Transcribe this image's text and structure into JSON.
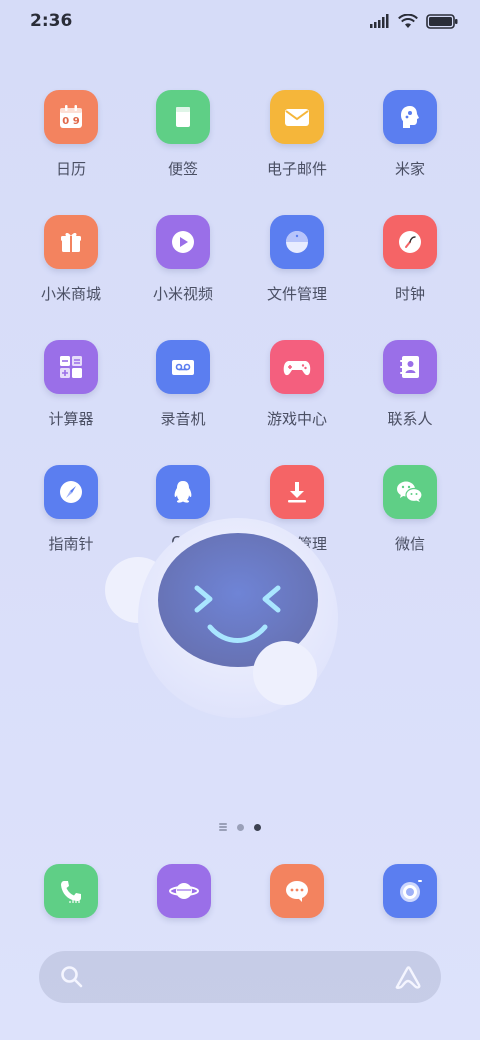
{
  "status_bar": {
    "time": "2:36"
  },
  "apps": [
    {
      "label": "日历",
      "icon": "calendar-icon",
      "color": "#f3835f",
      "icon_text": "0 9"
    },
    {
      "label": "便签",
      "icon": "notes-icon",
      "color": "#5fcf86"
    },
    {
      "label": "电子邮件",
      "icon": "email-icon",
      "color": "#f5b63a"
    },
    {
      "label": "米家",
      "icon": "mijia-icon",
      "color": "#5b7ef0"
    },
    {
      "label": "小米商城",
      "icon": "gift-icon",
      "color": "#f3835f"
    },
    {
      "label": "小米视频",
      "icon": "video-play-icon",
      "color": "#9a6fe8"
    },
    {
      "label": "文件管理",
      "icon": "file-manager-icon",
      "color": "#5b7ef0"
    },
    {
      "label": "时钟",
      "icon": "clock-icon",
      "color": "#f56466"
    },
    {
      "label": "计算器",
      "icon": "calculator-icon",
      "color": "#9a6fe8"
    },
    {
      "label": "录音机",
      "icon": "recorder-icon",
      "color": "#5b7ef0"
    },
    {
      "label": "游戏中心",
      "icon": "gamepad-icon",
      "color": "#f45f7e"
    },
    {
      "label": "联系人",
      "icon": "contacts-icon",
      "color": "#9a6fe8"
    },
    {
      "label": "指南针",
      "icon": "compass-icon",
      "color": "#5b7ef0"
    },
    {
      "label": "QQ",
      "icon": "qq-penguin-icon",
      "color": "#5b7ef0"
    },
    {
      "label": "下载管理",
      "icon": "download-icon",
      "color": "#f56466"
    },
    {
      "label": "微信",
      "icon": "wechat-icon",
      "color": "#5fcf86"
    }
  ],
  "dock": [
    {
      "icon": "phone-icon",
      "color": "#5fcf86"
    },
    {
      "icon": "browser-planet-icon",
      "color": "#9a6fe8"
    },
    {
      "icon": "messages-icon",
      "color": "#f3835f"
    },
    {
      "icon": "camera-icon",
      "color": "#5b7ef0"
    }
  ],
  "page_indicator": {
    "pages": 2,
    "current": 2
  }
}
